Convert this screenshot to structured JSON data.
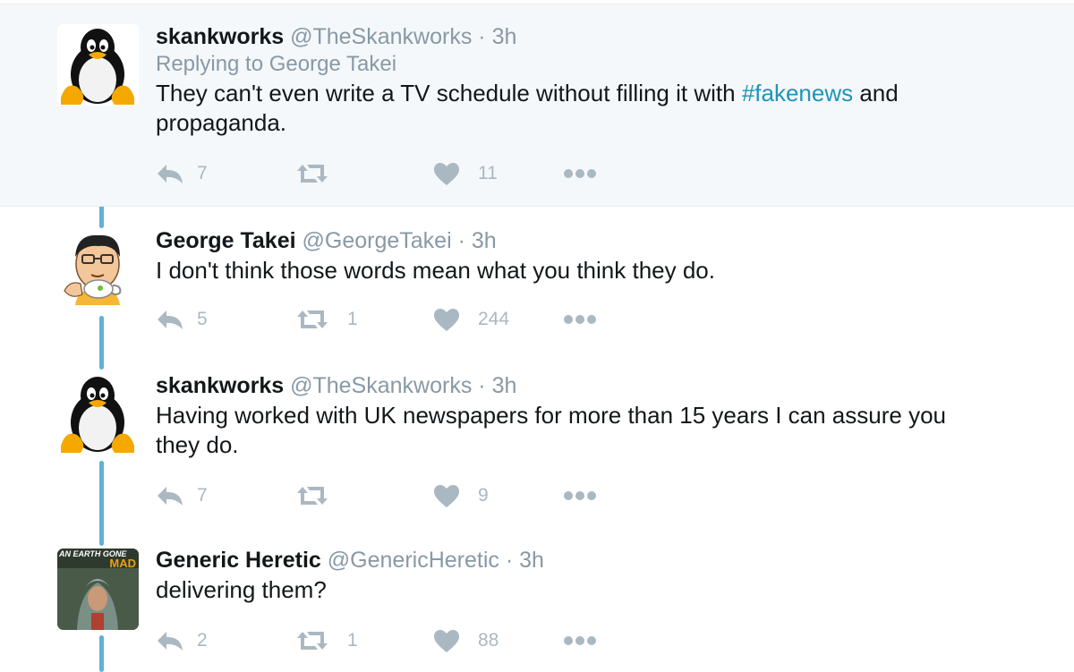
{
  "tweets": [
    {
      "name": "skankworks",
      "handle": "@TheSkankworks",
      "sep": "·",
      "time": "3h",
      "reply_to": "Replying to George Takei",
      "text_before": "They can't even write a TV schedule without filling it with ",
      "hashtag": "#fakenews",
      "text_after": " and propaganda.",
      "reply_count": "7",
      "retweet_count": "",
      "like_count": "11",
      "avatar_icon": "linux-penguin-avatar"
    },
    {
      "name": "George Takei",
      "handle": "@GeorgeTakei",
      "sep": "·",
      "time": "3h",
      "text": "I don't think those words mean what you think they do.",
      "reply_count": "5",
      "retweet_count": "1",
      "like_count": "244",
      "avatar_icon": "cartoon-man-drinking-tea-avatar"
    },
    {
      "name": "skankworks",
      "handle": "@TheSkankworks",
      "sep": "·",
      "time": "3h",
      "text": "Having worked with UK newspapers for more than 15 years I can assure you they do.",
      "reply_count": "7",
      "retweet_count": "",
      "like_count": "9",
      "avatar_icon": "linux-penguin-avatar"
    },
    {
      "name": "Generic Heretic",
      "handle": "@GenericHeretic",
      "sep": "·",
      "time": "3h",
      "text": "delivering them?",
      "reply_count": "2",
      "retweet_count": "1",
      "like_count": "88",
      "avatar_icon": "book-cover-avatar",
      "avatar_text_top": "AN EARTH GONE",
      "avatar_text_bottom": "MAD"
    }
  ],
  "colors": {
    "highlight_bg": "#f5f8fa",
    "connector": "#5fb1d7",
    "action_gray": "#aab8c2",
    "hashtag": "#1b95b8",
    "muted": "#8899a6"
  }
}
